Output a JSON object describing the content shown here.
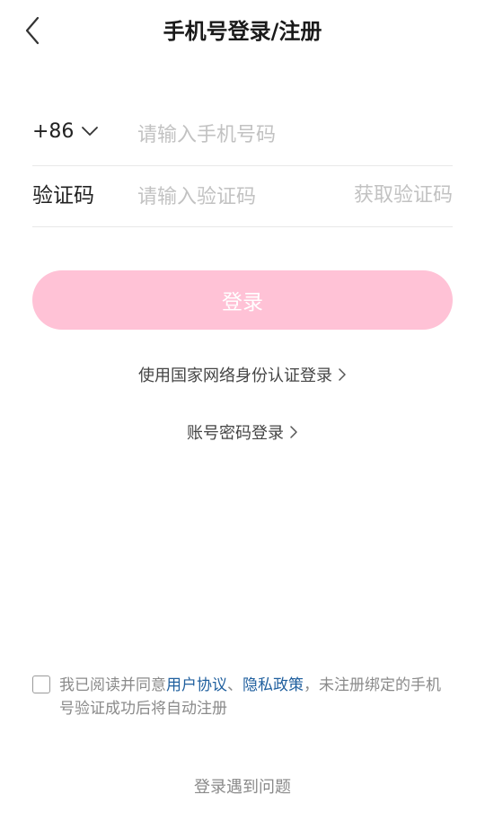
{
  "header": {
    "back_icon": "chevron-left-icon",
    "title": "手机号登录/注册"
  },
  "phone_row": {
    "country_code": "+86",
    "dropdown_icon": "chevron-down-icon",
    "input_value": "",
    "input_placeholder": "请输入手机号码"
  },
  "code_row": {
    "label": "验证码",
    "input_value": "",
    "input_placeholder": "请输入验证码",
    "get_code_label": "获取验证码"
  },
  "login_button": {
    "label": "登录",
    "bg_color": "#ffc2d6"
  },
  "links": {
    "national_id_login": "使用国家网络身份认证登录",
    "password_login": "账号密码登录",
    "arrow_icon": "chevron-right-icon"
  },
  "agreement": {
    "checked": false,
    "prefix": "我已阅读并同意",
    "user_agreement": "用户协议",
    "separator": "、",
    "privacy_policy": "隐私政策",
    "suffix": "，未注册绑定的手机号验证成功后将自动注册",
    "link_color": "#1f5f9e"
  },
  "footer": {
    "help_label": "登录遇到问题"
  }
}
